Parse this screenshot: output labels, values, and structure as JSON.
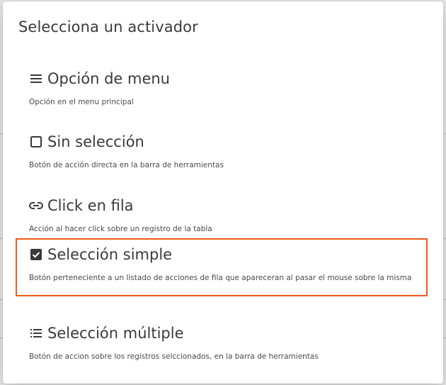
{
  "dialog": {
    "title": "Selecciona un activador"
  },
  "options": [
    {
      "label": "Opción de menu",
      "description": "Opción en el menu principal",
      "icon": "menu-icon",
      "selected": false
    },
    {
      "label": "Sin selección",
      "description": "Botón de acción directa en la barra de herramientas",
      "icon": "checkbox-empty-icon",
      "selected": false
    },
    {
      "label": "Click en fila",
      "description": "Acción al hacer click sobre un registro de la tabla",
      "icon": "link-icon",
      "selected": false
    },
    {
      "label": "Selección simple",
      "description": "Botón perteneciente a un listado de acciones de fila que apareceran al pasar el mouse sobre la misma",
      "icon": "checkbox-checked-icon",
      "selected": true
    },
    {
      "label": "Selección múltiple",
      "description": "Botón de accion sobre los registros selccionados, en la barra de herramientas",
      "icon": "list-icon",
      "selected": false
    }
  ],
  "colors": {
    "selected_border": "#f05a1a",
    "text": "#3a3a3a"
  }
}
